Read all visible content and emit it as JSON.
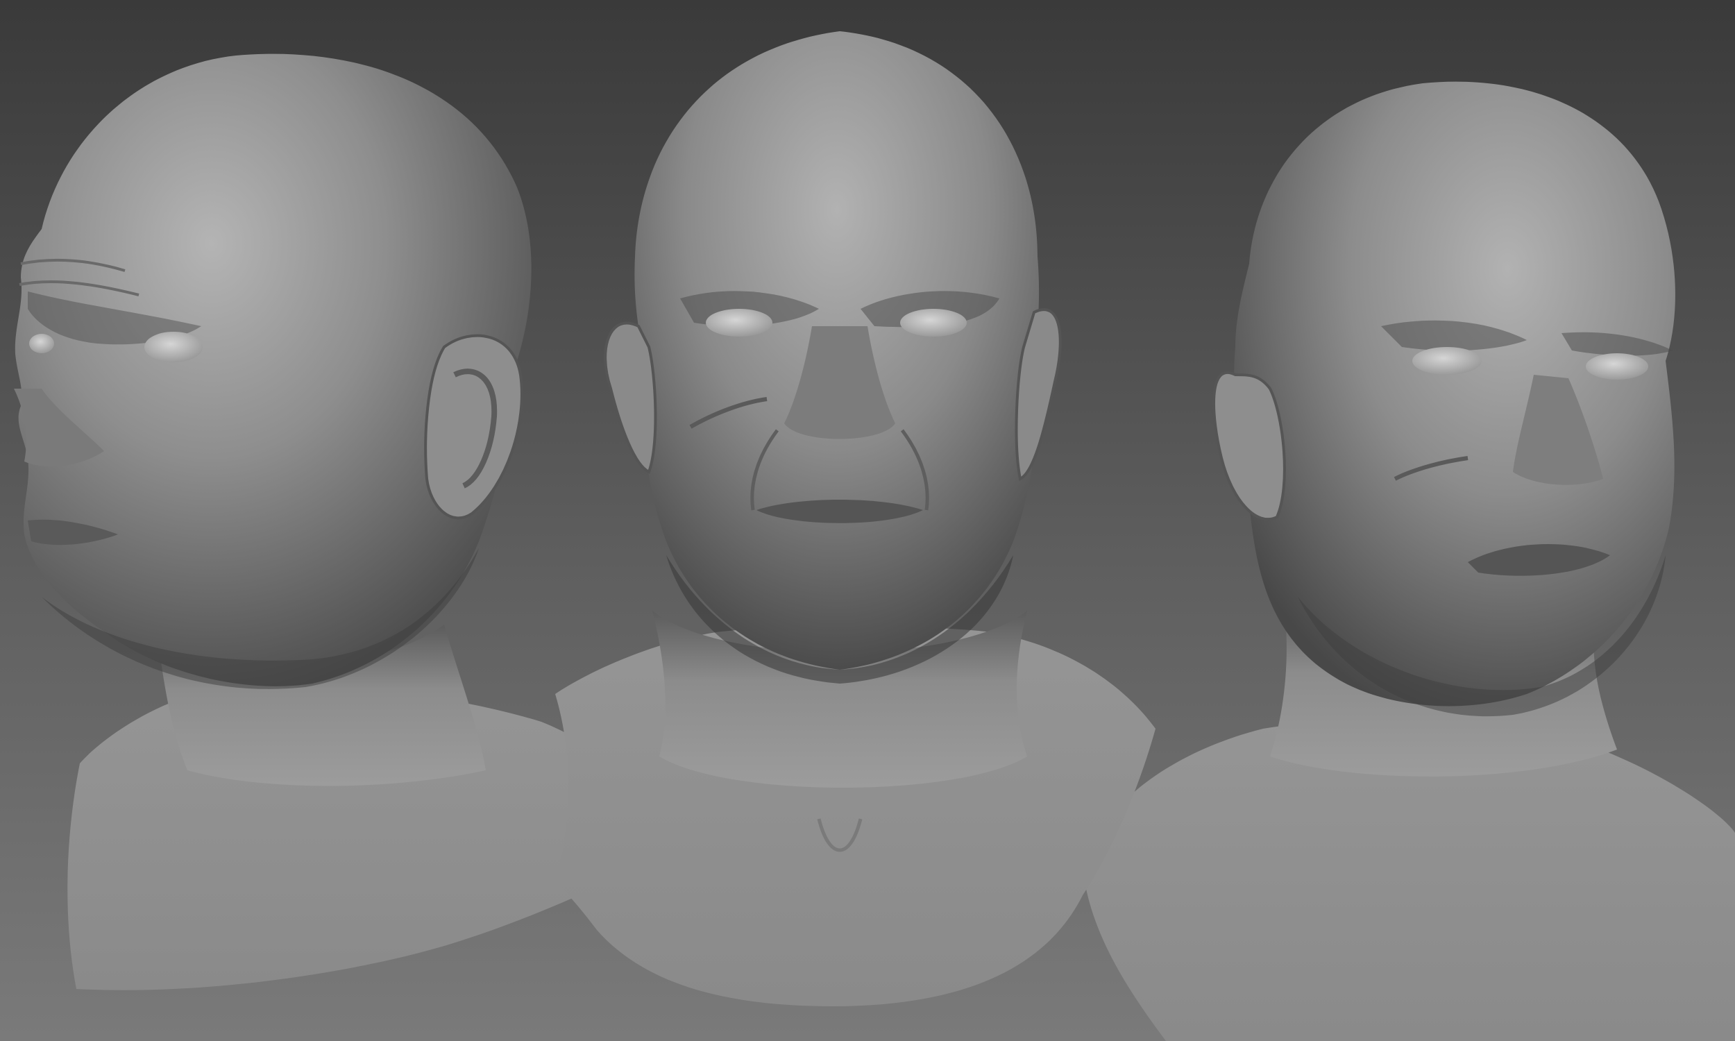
{
  "scene": {
    "views": [
      {
        "name": "three-quarter-left"
      },
      {
        "name": "front"
      },
      {
        "name": "three-quarter-right"
      }
    ],
    "colors": {
      "background_top": "#3c3c3c",
      "background_bottom": "#787878",
      "clay_light": "#a8a8a8",
      "clay_mid": "#8a8a8a",
      "clay_dark": "#505050",
      "shadow": "#2c2c2c"
    }
  }
}
